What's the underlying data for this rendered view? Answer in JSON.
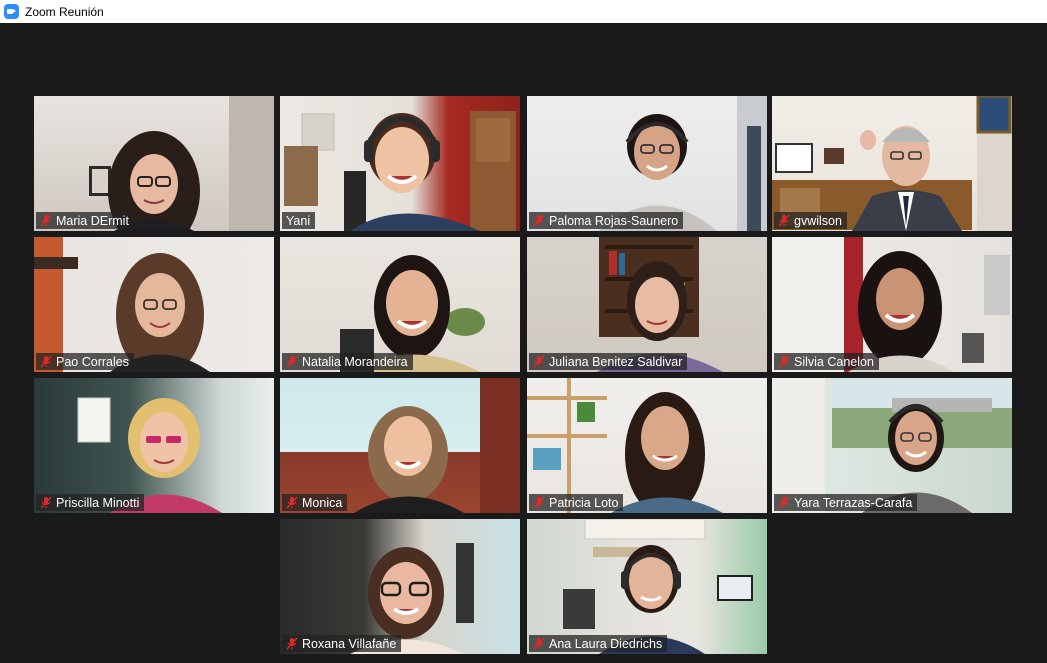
{
  "window": {
    "title": "Zoom Reunión",
    "app_icon": "zoom-camera-icon"
  },
  "colors": {
    "background": "#1a1a1a",
    "active_speaker_border": "#d6e86a",
    "mute": "#e02828"
  },
  "participants": [
    {
      "name": "Maria DErmit",
      "muted": true,
      "active": false
    },
    {
      "name": "Yani",
      "muted": false,
      "active": true
    },
    {
      "name": "Paloma Rojas-Saunero",
      "muted": true,
      "active": false
    },
    {
      "name": "gvwilson",
      "muted": true,
      "active": false
    },
    {
      "name": "Pao Corrales",
      "muted": true,
      "active": false
    },
    {
      "name": "Natalia Morandeira",
      "muted": true,
      "active": false
    },
    {
      "name": "Juliana Benitez Saldivar",
      "muted": true,
      "active": false
    },
    {
      "name": "Silvia Canelon",
      "muted": true,
      "active": false
    },
    {
      "name": "Priscilla Minotti",
      "muted": true,
      "active": false
    },
    {
      "name": "Monica",
      "muted": true,
      "active": false
    },
    {
      "name": "Patricia Loto",
      "muted": true,
      "active": false
    },
    {
      "name": "Yara Terrazas-Carafa",
      "muted": true,
      "active": false
    },
    {
      "name": "Roxana Villafañe",
      "muted": true,
      "active": false
    },
    {
      "name": "Ana Laura Diedrichs",
      "muted": true,
      "active": false
    }
  ]
}
